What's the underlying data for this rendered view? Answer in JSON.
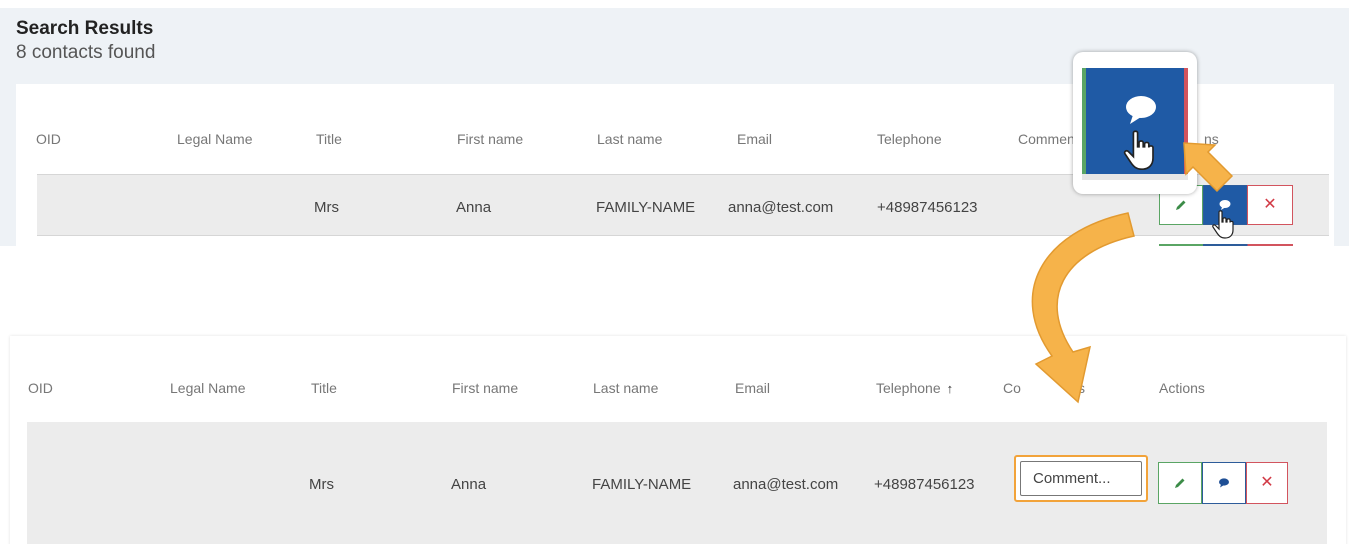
{
  "results": {
    "title": "Search Results",
    "count": "8 contacts found"
  },
  "table_top": {
    "headers": {
      "oid": "OID",
      "legal_name": "Legal Name",
      "title": "Title",
      "first_name": "First name",
      "last_name": "Last name",
      "email": "Email",
      "telephone": "Telephone",
      "comments": "Commen",
      "actions": "ns"
    },
    "row": {
      "oid": "",
      "legal_name": "",
      "title": "Mrs",
      "first_name": "Anna",
      "last_name": "FAMILY-NAME",
      "email": "anna@test.com",
      "telephone": "+48987456123"
    }
  },
  "table_bottom": {
    "headers": {
      "oid": "OID",
      "legal_name": "Legal Name",
      "title": "Title",
      "first_name": "First name",
      "last_name": "Last name",
      "email": "Email",
      "telephone": "Telephone",
      "comments_left": "Co",
      "comments_right": "s",
      "actions": "Actions"
    },
    "sort_indicator": "↑",
    "row": {
      "oid": "",
      "legal_name": "",
      "title": "Mrs",
      "first_name": "Anna",
      "last_name": "FAMILY-NAME",
      "email": "anna@test.com",
      "telephone": "+48987456123"
    },
    "comment_placeholder": "Comment..."
  },
  "icons": {
    "edit": "pencil-icon",
    "comment": "speech-bubble-icon",
    "delete": "close-icon",
    "cursor": "hand-pointer-icon",
    "callout_arrow": "arrow-icon"
  },
  "colors": {
    "edit_green": "#5aa564",
    "comment_blue": "#1f5aa5",
    "delete_red": "#d2545e",
    "highlight_orange": "#f2a33a",
    "arrow_orange": "#f6b34a"
  }
}
